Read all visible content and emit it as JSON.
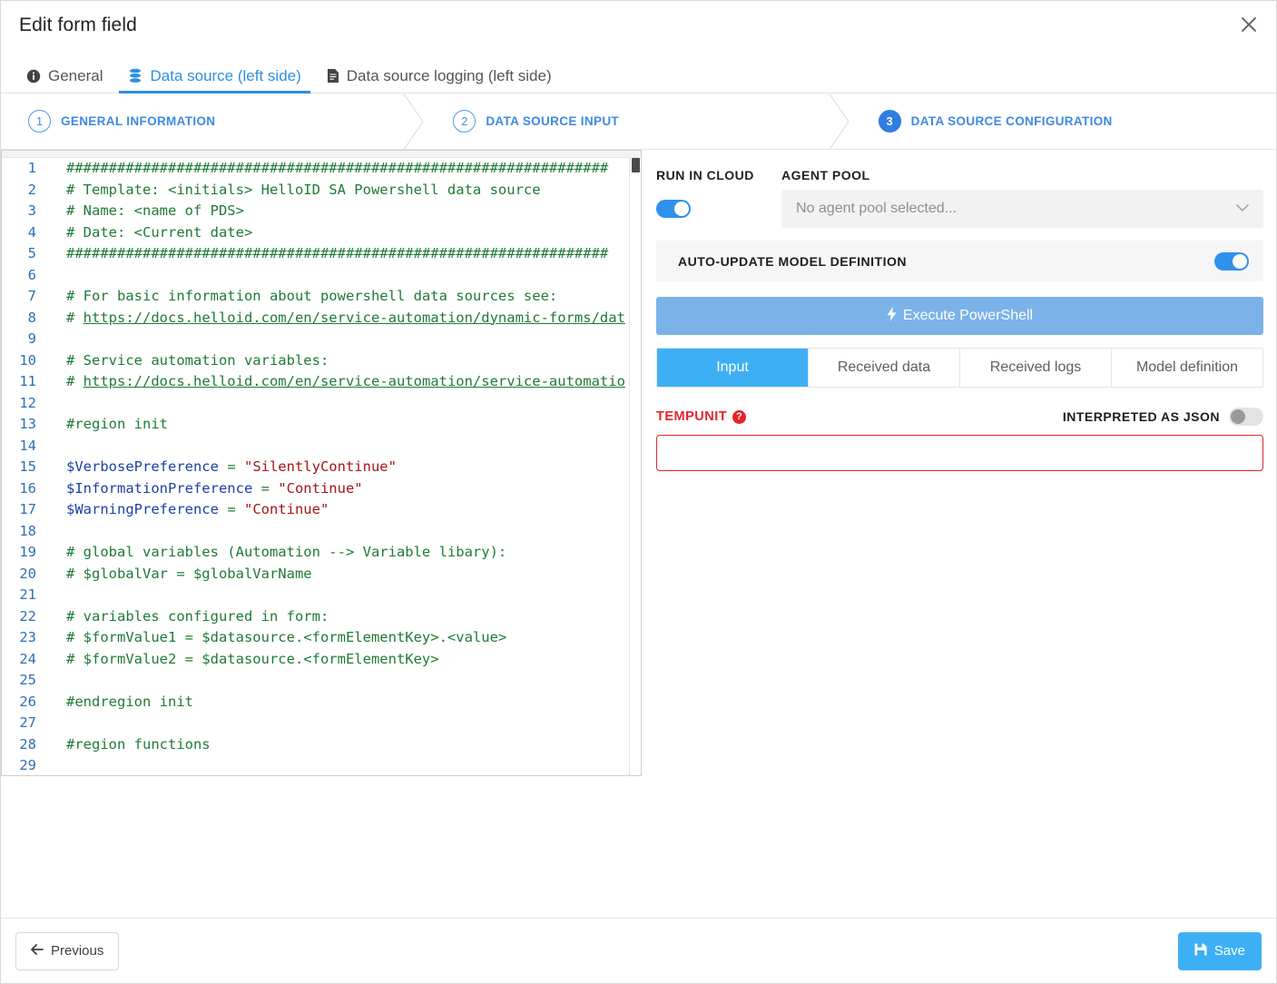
{
  "window": {
    "title": "Edit form field",
    "close_icon": "close-icon"
  },
  "tabs": [
    {
      "label": "General",
      "icon": "info-icon",
      "active": false
    },
    {
      "label": "Data source (left side)",
      "icon": "database-icon",
      "active": true
    },
    {
      "label": "Data source logging (left side)",
      "icon": "document-icon",
      "active": false
    }
  ],
  "stepper": [
    {
      "number": "1",
      "label": "GENERAL INFORMATION",
      "current": false
    },
    {
      "number": "2",
      "label": "DATA SOURCE INPUT",
      "current": false
    },
    {
      "number": "3",
      "label": "DATA SOURCE CONFIGURATION",
      "current": true
    }
  ],
  "editor": {
    "language": "powershell",
    "lines": [
      {
        "n": "1",
        "segments": [
          {
            "t": "################################################################",
            "c": "cm"
          }
        ]
      },
      {
        "n": "2",
        "segments": [
          {
            "t": "# Template: <initials> HelloID SA Powershell data source",
            "c": "cm"
          }
        ]
      },
      {
        "n": "3",
        "segments": [
          {
            "t": "# Name: <name of PDS>",
            "c": "cm"
          }
        ]
      },
      {
        "n": "4",
        "segments": [
          {
            "t": "# Date: <Current date>",
            "c": "cm"
          }
        ]
      },
      {
        "n": "5",
        "segments": [
          {
            "t": "################################################################",
            "c": "cm"
          }
        ]
      },
      {
        "n": "6",
        "segments": [
          {
            "t": "",
            "c": "cm"
          }
        ]
      },
      {
        "n": "7",
        "segments": [
          {
            "t": "# For basic information about powershell data sources see:",
            "c": "cm"
          }
        ]
      },
      {
        "n": "8",
        "segments": [
          {
            "t": "# ",
            "c": "cm"
          },
          {
            "t": "https://docs.helloid.com/en/service-automation/dynamic-forms/dat",
            "c": "lnk"
          }
        ]
      },
      {
        "n": "9",
        "segments": [
          {
            "t": "",
            "c": "cm"
          }
        ]
      },
      {
        "n": "10",
        "segments": [
          {
            "t": "# Service automation variables:",
            "c": "cm"
          }
        ]
      },
      {
        "n": "11",
        "segments": [
          {
            "t": "# ",
            "c": "cm"
          },
          {
            "t": "https://docs.helloid.com/en/service-automation/service-automatio",
            "c": "lnk"
          }
        ]
      },
      {
        "n": "12",
        "segments": [
          {
            "t": "",
            "c": "cm"
          }
        ]
      },
      {
        "n": "13",
        "segments": [
          {
            "t": "#region init",
            "c": "cm"
          }
        ]
      },
      {
        "n": "14",
        "segments": [
          {
            "t": "",
            "c": "cm"
          }
        ]
      },
      {
        "n": "15",
        "segments": [
          {
            "t": "$VerbosePreference",
            "c": "var"
          },
          {
            "t": " = ",
            "c": "cm"
          },
          {
            "t": "\"SilentlyContinue\"",
            "c": "str"
          }
        ]
      },
      {
        "n": "16",
        "segments": [
          {
            "t": "$InformationPreference",
            "c": "var"
          },
          {
            "t": " = ",
            "c": "cm"
          },
          {
            "t": "\"Continue\"",
            "c": "str"
          }
        ]
      },
      {
        "n": "17",
        "segments": [
          {
            "t": "$WarningPreference",
            "c": "var"
          },
          {
            "t": " = ",
            "c": "cm"
          },
          {
            "t": "\"Continue\"",
            "c": "str"
          }
        ]
      },
      {
        "n": "18",
        "segments": [
          {
            "t": "",
            "c": "cm"
          }
        ]
      },
      {
        "n": "19",
        "segments": [
          {
            "t": "# global variables (Automation --> Variable libary):",
            "c": "cm"
          }
        ]
      },
      {
        "n": "20",
        "segments": [
          {
            "t": "# $globalVar = $globalVarName",
            "c": "cm"
          }
        ]
      },
      {
        "n": "21",
        "segments": [
          {
            "t": "",
            "c": "cm"
          }
        ]
      },
      {
        "n": "22",
        "segments": [
          {
            "t": "# variables configured in form:",
            "c": "cm"
          }
        ]
      },
      {
        "n": "23",
        "segments": [
          {
            "t": "# $formValue1 = $datasource.<formElementKey>.<value>",
            "c": "cm"
          }
        ]
      },
      {
        "n": "24",
        "segments": [
          {
            "t": "# $formValue2 = $datasource.<formElementKey>",
            "c": "cm"
          }
        ]
      },
      {
        "n": "25",
        "segments": [
          {
            "t": "",
            "c": "cm"
          }
        ]
      },
      {
        "n": "26",
        "segments": [
          {
            "t": "#endregion init",
            "c": "cm"
          }
        ]
      },
      {
        "n": "27",
        "segments": [
          {
            "t": "",
            "c": "cm"
          }
        ]
      },
      {
        "n": "28",
        "segments": [
          {
            "t": "#region functions",
            "c": "cm"
          }
        ]
      },
      {
        "n": "29",
        "segments": [
          {
            "t": "",
            "c": "cm"
          }
        ]
      }
    ]
  },
  "panel": {
    "run_in_cloud_label": "RUN IN CLOUD",
    "run_in_cloud_on": true,
    "agent_pool_label": "AGENT POOL",
    "agent_pool_value": "No agent pool selected...",
    "auto_update_label": "AUTO-UPDATE MODEL DEFINITION",
    "auto_update_on": true,
    "execute_label": "Execute PowerShell",
    "execute_icon": "lightning-icon",
    "subtabs": [
      {
        "label": "Input",
        "active": true
      },
      {
        "label": "Received data",
        "active": false
      },
      {
        "label": "Received logs",
        "active": false
      },
      {
        "label": "Model definition",
        "active": false
      }
    ],
    "field": {
      "label": "TEMPUNIT",
      "help_icon": "question-mark-icon",
      "value": "",
      "placeholder": ""
    },
    "json_toggle_label": "INTERPRETED AS JSON",
    "json_toggle_on": false
  },
  "footer": {
    "previous_label": "Previous",
    "previous_icon": "arrow-left-icon",
    "save_label": "Save",
    "save_icon": "floppy-disk-icon"
  },
  "colors": {
    "accent_blue": "#3db0f5",
    "step_blue": "#2f7de1",
    "tab_blue": "#2f8fe0",
    "exec_blue": "#7bb2e8",
    "error_red": "#e3242b",
    "comment_green": "#1f7a37",
    "string_red": "#a31515",
    "variable_blue": "#1c3fa8",
    "linenumber_blue": "#2f6fb5"
  }
}
